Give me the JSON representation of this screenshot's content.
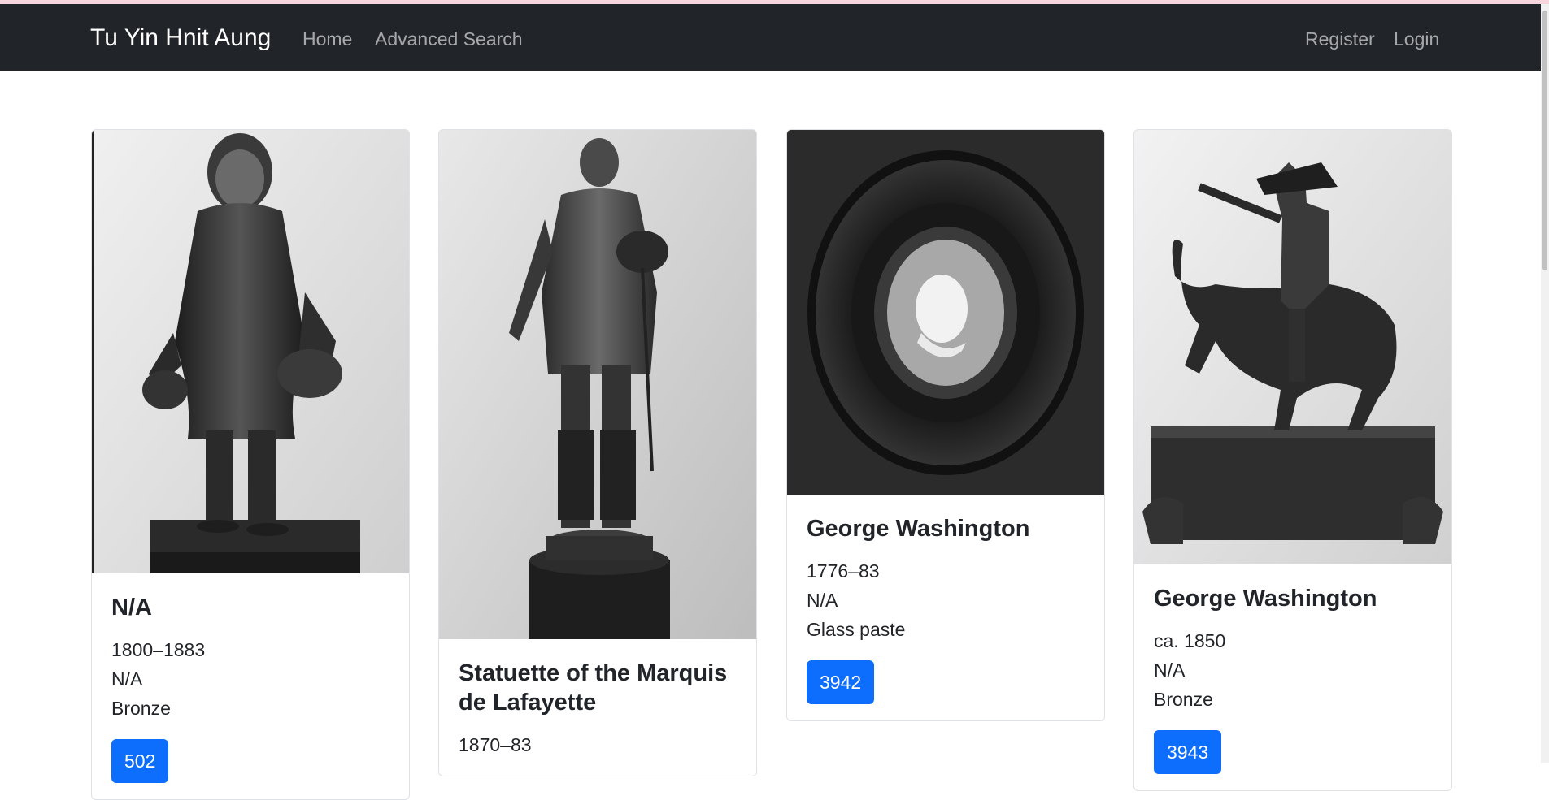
{
  "navbar": {
    "brand": "Tu Yin Hnit Aung",
    "links": [
      "Home",
      "Advanced Search"
    ],
    "right_links": [
      "Register",
      "Login"
    ]
  },
  "cards": [
    {
      "title": "N/A",
      "date": "1800–1883",
      "culture": "N/A",
      "medium": "Bronze",
      "button": "502",
      "image": "bronze-statuette-standing-man-image"
    },
    {
      "title": "Statuette of the Marquis de Lafayette",
      "date": "1870–83",
      "image": "statuette-lafayette-image"
    },
    {
      "title": "George Washington",
      "date": "1776–83",
      "culture": "N/A",
      "medium": "Glass paste",
      "button": "3942",
      "image": "glass-paste-medallion-image"
    },
    {
      "title": "George Washington",
      "date": "ca. 1850",
      "culture": "N/A",
      "medium": "Bronze",
      "button": "3943",
      "image": "equestrian-statue-image"
    }
  ],
  "colors": {
    "navbar_bg": "#212529",
    "primary_button": "#0d6efd"
  }
}
